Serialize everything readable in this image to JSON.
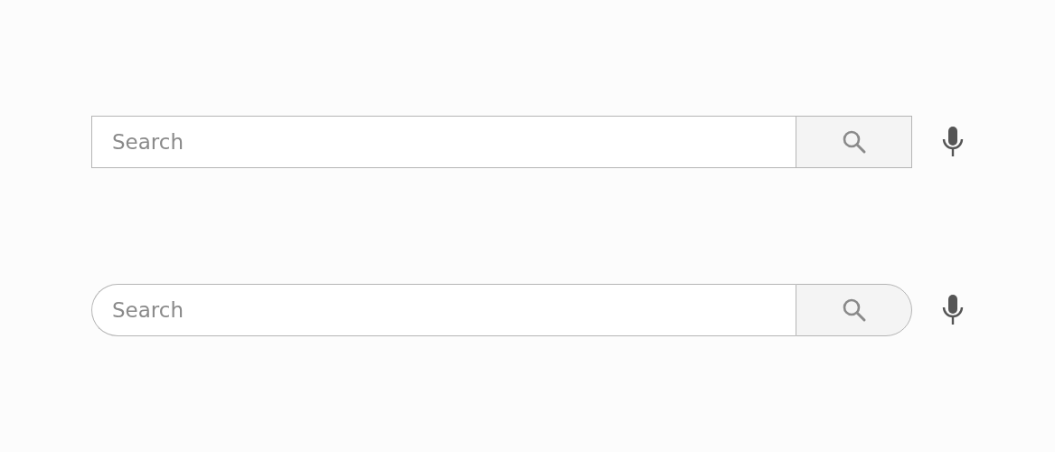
{
  "search_bars": [
    {
      "kind": "square",
      "placeholder": "Search"
    },
    {
      "kind": "rounded",
      "placeholder": "Search"
    }
  ]
}
